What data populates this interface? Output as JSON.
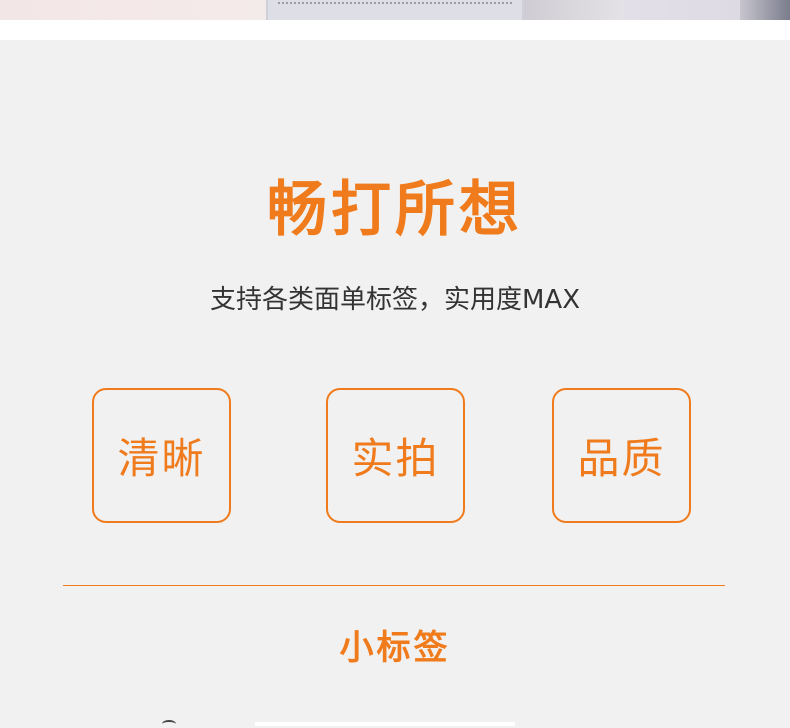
{
  "banner": {
    "title": "畅打所想",
    "subtitle": "支持各类面单标签，实用度MAX"
  },
  "features": [
    {
      "label": "清晰"
    },
    {
      "label": "实拍"
    },
    {
      "label": "品质"
    }
  ],
  "section": {
    "title": "小标签"
  },
  "colors": {
    "accent": "#f07b1c",
    "background": "#f1f1f1",
    "text": "#333333"
  }
}
